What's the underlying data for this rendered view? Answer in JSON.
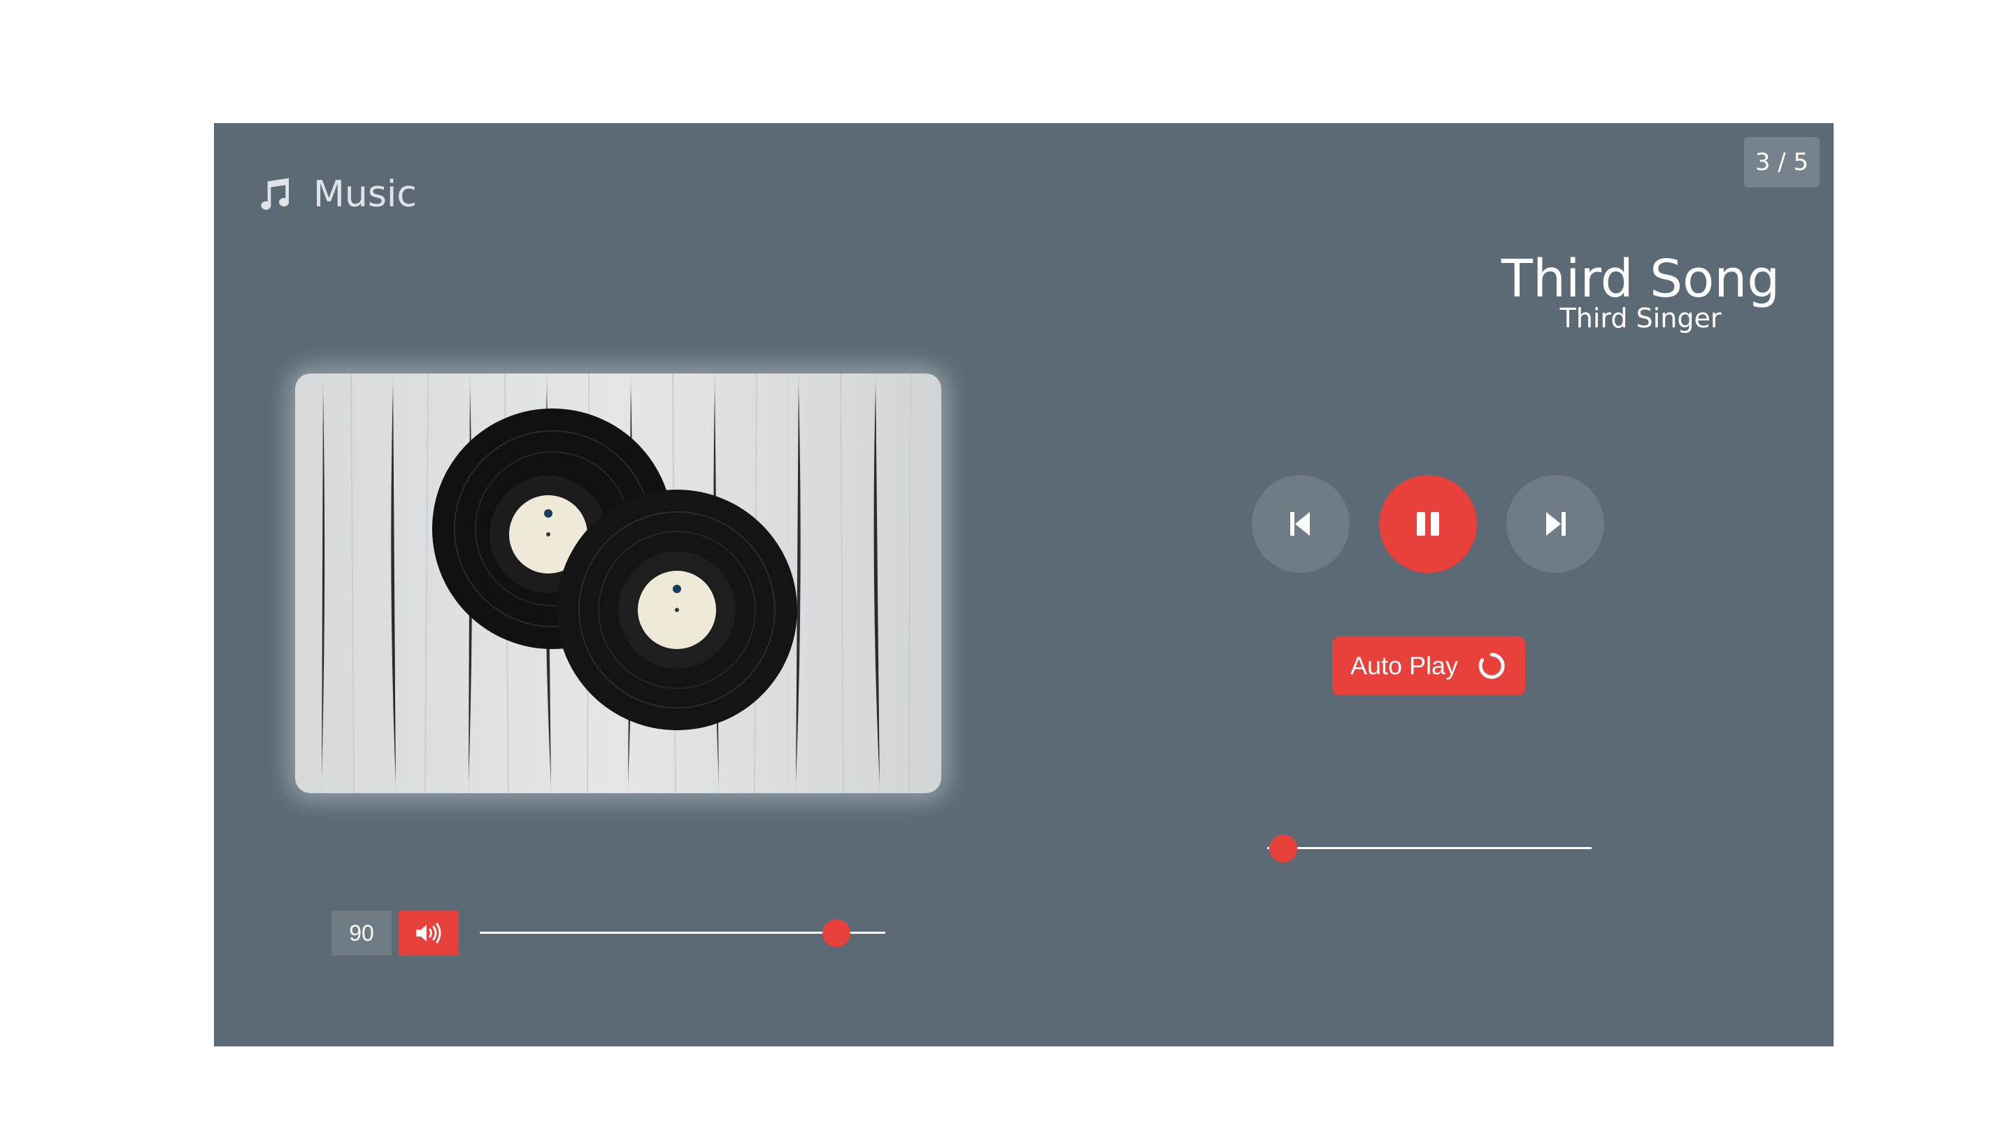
{
  "player": {
    "brand_label": "Music",
    "counter": "3 / 5",
    "track": {
      "title": "Third Song",
      "artist": "Third Singer",
      "progress_fraction": 0.05
    },
    "controls": {
      "prev_icon": "skip-back-icon",
      "play_icon": "pause-icon",
      "next_icon": "skip-forward-icon"
    },
    "autoplay": {
      "label": "Auto Play",
      "icon": "refresh-icon"
    },
    "volume": {
      "value": "90",
      "icon": "speaker-icon",
      "level_fraction": 0.88
    },
    "artwork_icon": "vinyl-records-image",
    "colors": {
      "background": "#5c6a75",
      "accent": "#e8413b",
      "muted_button": "#6f7c86"
    }
  }
}
